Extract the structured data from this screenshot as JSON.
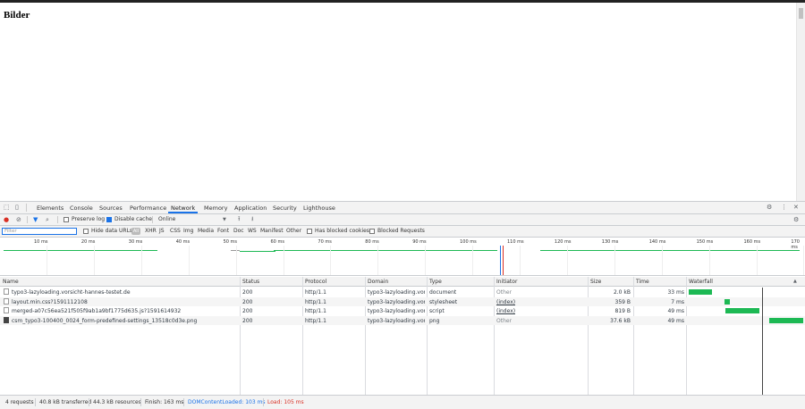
{
  "page": {
    "heading": "Bilder"
  },
  "devtools": {
    "tabs": [
      "Elements",
      "Console",
      "Sources",
      "Performance",
      "Network",
      "Memory",
      "Application",
      "Security",
      "Lighthouse"
    ],
    "active_tab": "Network"
  },
  "toolbar": {
    "preserve_log": "Preserve log",
    "disable_cache": "Disable cache",
    "throttling": "Online"
  },
  "filterbar": {
    "placeholder": "Filter",
    "hide_data_urls": "Hide data URLs",
    "all": "All",
    "types": [
      "XHR",
      "JS",
      "CSS",
      "Img",
      "Media",
      "Font",
      "Doc",
      "WS",
      "Manifest",
      "Other"
    ],
    "has_blocked_cookies": "Has blocked cookies",
    "blocked_requests": "Blocked Requests"
  },
  "timeline": {
    "ticks": [
      "10 ms",
      "20 ms",
      "30 ms",
      "40 ms",
      "50 ms",
      "60 ms",
      "70 ms",
      "80 ms",
      "90 ms",
      "100 ms",
      "110 ms",
      "120 ms",
      "130 ms",
      "140 ms",
      "150 ms",
      "160 ms",
      "170 ms"
    ]
  },
  "table": {
    "columns": [
      "Name",
      "Status",
      "Protocol",
      "Domain",
      "Type",
      "Initiator",
      "Size",
      "Time",
      "Waterfall"
    ],
    "rows": [
      {
        "name": "typo3-lazyloading.vorsicht-hannes-testet.de",
        "status": "200",
        "protocol": "http/1.1",
        "domain": "typo3-lazyloading.vor...",
        "type": "document",
        "initiator": "Other",
        "size": "2.0 kB",
        "time": "33 ms"
      },
      {
        "name": "layout.min.css?1591112108",
        "status": "200",
        "protocol": "http/1.1",
        "domain": "typo3-lazyloading.vor...",
        "type": "stylesheet",
        "initiator": "(index)",
        "size": "359 B",
        "time": "7 ms"
      },
      {
        "name": "merged-a07c56ea521f505f9ab1a9bf1775d635.js?1591614932",
        "status": "200",
        "protocol": "http/1.1",
        "domain": "typo3-lazyloading.vor...",
        "type": "script",
        "initiator": "(index)",
        "size": "819 B",
        "time": "49 ms"
      },
      {
        "name": "csm_typo3-100400_0024_form-predefined-settings_13518c0d3e.png",
        "status": "200",
        "protocol": "http/1.1",
        "domain": "typo3-lazyloading.vor...",
        "type": "png",
        "initiator": "Other",
        "size": "37.6 kB",
        "time": "49 ms"
      }
    ]
  },
  "statusbar": {
    "requests": "4 requests",
    "transferred": "40.8 kB transferred",
    "resources": "44.3 kB resources",
    "finish": "Finish: 163 ms",
    "dom_content_loaded": "DOMContentLoaded: 103 ms",
    "load": "Load: 105 ms"
  },
  "colors": {
    "accent": "#1a73e8",
    "waterfall_bar": "#1db954",
    "dcl": "#1a73e8",
    "load": "#d93025"
  }
}
